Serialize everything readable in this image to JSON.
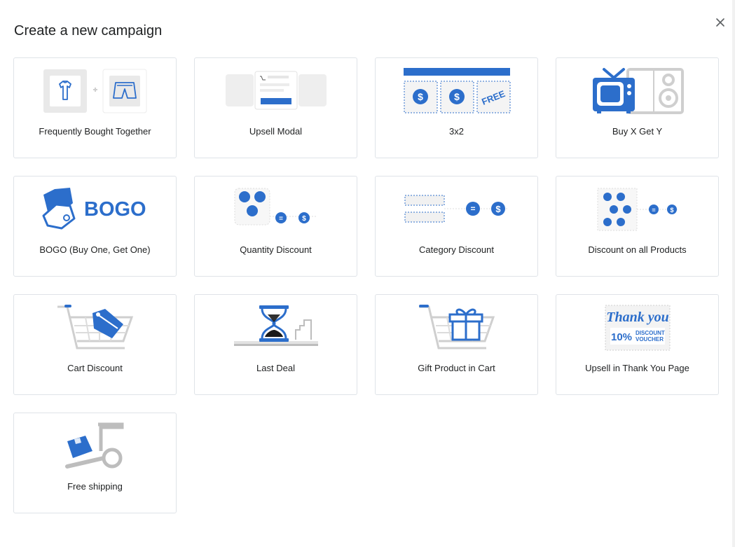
{
  "dialog": {
    "title": "Create a new campaign",
    "close_icon": "close-icon"
  },
  "colors": {
    "accent": "#2c6ecb",
    "muted": "#d6d6d6",
    "border": "#dfe3e8"
  },
  "campaigns": [
    {
      "id": "frequently-bought-together",
      "label": "Frequently Bought Together",
      "icon": "shirt-and-shorts-icon"
    },
    {
      "id": "upsell-modal",
      "label": "Upsell Modal",
      "icon": "modal-window-icon"
    },
    {
      "id": "3x2",
      "label": "3x2",
      "icon": "three-for-two-icon",
      "art_text": "FREE"
    },
    {
      "id": "buy-x-get-y",
      "label": "Buy X Get Y",
      "icon": "tv-and-speaker-icon"
    },
    {
      "id": "bogo",
      "label": "BOGO (Buy One, Get One)",
      "icon": "price-tags-icon",
      "art_text": "BOGO"
    },
    {
      "id": "quantity-discount",
      "label": "Quantity Discount",
      "icon": "quantity-dots-icon"
    },
    {
      "id": "category-discount",
      "label": "Category Discount",
      "icon": "category-bars-icon"
    },
    {
      "id": "discount-all-products",
      "label": "Discount on all Products",
      "icon": "all-products-dots-icon"
    },
    {
      "id": "cart-discount",
      "label": "Cart Discount",
      "icon": "cart-with-tag-icon"
    },
    {
      "id": "last-deal",
      "label": "Last Deal",
      "icon": "hourglass-icon"
    },
    {
      "id": "gift-product-in-cart",
      "label": "Gift Product in Cart",
      "icon": "cart-with-gift-icon"
    },
    {
      "id": "upsell-thank-you",
      "label": "Upsell in Thank You Page",
      "icon": "thank-you-voucher-icon",
      "art_text": {
        "line1": "Thank you",
        "percent": "10%",
        "discount": "DISCOUNT",
        "voucher": "VOUCHER"
      }
    },
    {
      "id": "free-shipping",
      "label": "Free shipping",
      "icon": "hand-truck-box-icon"
    }
  ]
}
